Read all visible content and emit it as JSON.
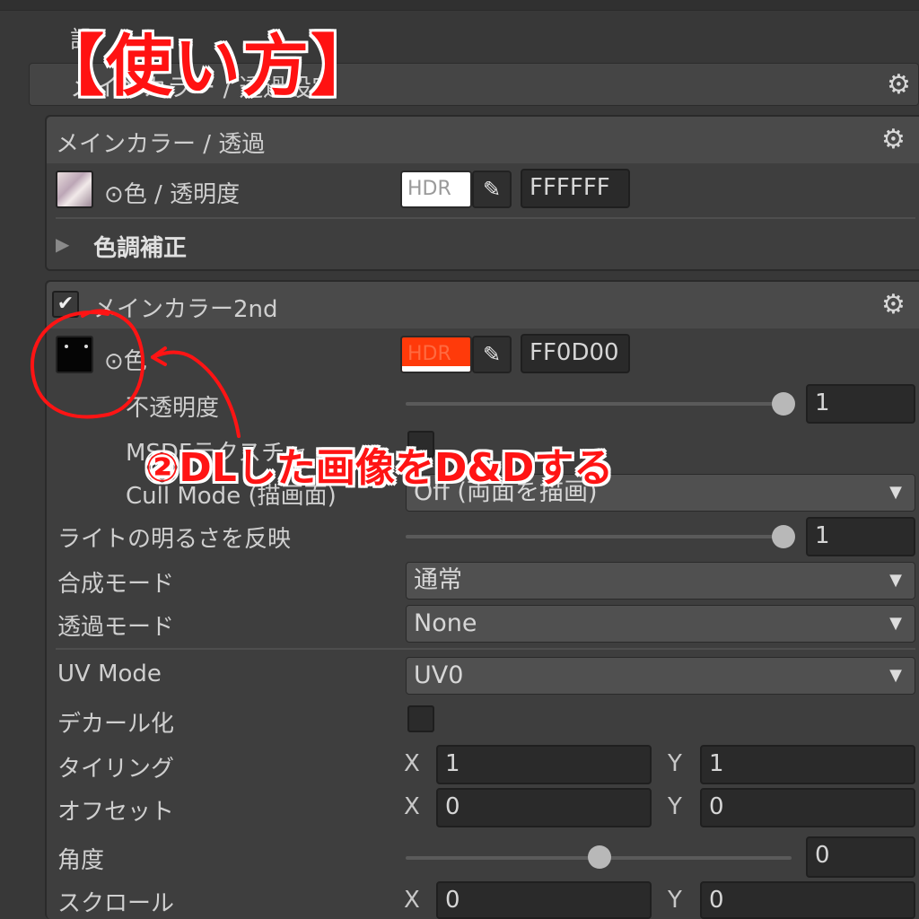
{
  "overlay": {
    "title": "【使い方】",
    "note": "②DLした画像をD&Dする"
  },
  "outer_header": {
    "partial_text": "設",
    "label": "メインカラー / 透過設定"
  },
  "panel_main": {
    "header": "メインカラー / 透過",
    "color_label": "⊙色 / 透明度",
    "hdr_label": "HDR",
    "hex": "FFFFFF",
    "color_adjust": "色調補正"
  },
  "panel_2nd": {
    "header": "メインカラー2nd",
    "enabled": true,
    "color_label": "⊙色",
    "hdr_label": "HDR",
    "hex": "FF0D00",
    "swatch_color": "#ff3a0a",
    "opacity_label": "不透明度",
    "opacity_value": "1",
    "opacity_level": 1.0,
    "msdf_label": "MSDFテクスチャ",
    "cull_label": "Cull Mode (描画面)",
    "cull_value": "Off (両面を描画)",
    "light_label": "ライトの明るさを反映",
    "light_value": "1",
    "light_level": 1.0,
    "blend_label": "合成モード",
    "blend_value": "通常",
    "alpha_label": "透過モード",
    "alpha_value": "None",
    "uv_label": "UV Mode",
    "uv_value": "UV0",
    "decal_label": "デカール化",
    "tiling_label": "タイリング",
    "tiling_x": "1",
    "tiling_y": "1",
    "offset_label": "オフセット",
    "offset_x": "0",
    "offset_y": "0",
    "angle_label": "角度",
    "angle_value": "0",
    "angle_level": 0.5,
    "scroll_label": "スクロール",
    "scroll_x": "0",
    "scroll_y": "0",
    "x_axis": "X",
    "y_axis": "Y"
  },
  "colors": {
    "annotation_red": "#ff1414",
    "background": "#383838"
  }
}
